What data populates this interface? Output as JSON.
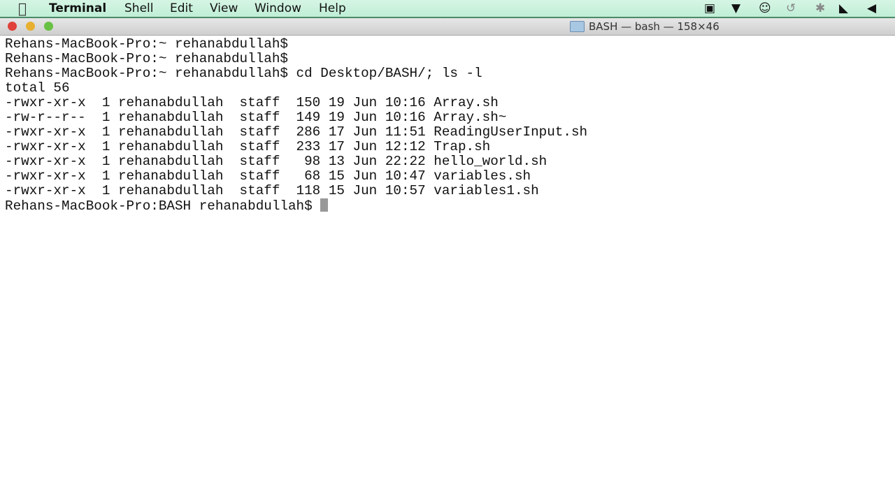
{
  "menubar": {
    "app": "Terminal",
    "items": [
      "Shell",
      "Edit",
      "View",
      "Window",
      "Help"
    ],
    "status_icons": [
      "screen-record-icon",
      "airplay-icon",
      "accessibility-icon",
      "time-machine-icon",
      "bluetooth-icon",
      "wifi-icon",
      "volume-icon"
    ]
  },
  "window": {
    "title": "BASH — bash — 158×46"
  },
  "terminal": {
    "lines": [
      "Rehans-MacBook-Pro:~ rehanabdullah$",
      "Rehans-MacBook-Pro:~ rehanabdullah$",
      "Rehans-MacBook-Pro:~ rehanabdullah$ cd Desktop/BASH/; ls -l",
      "total 56",
      "-rwxr-xr-x  1 rehanabdullah  staff  150 19 Jun 10:16 Array.sh",
      "-rw-r--r--  1 rehanabdullah  staff  149 19 Jun 10:16 Array.sh~",
      "-rwxr-xr-x  1 rehanabdullah  staff  286 17 Jun 11:51 ReadingUserInput.sh",
      "-rwxr-xr-x  1 rehanabdullah  staff  233 17 Jun 12:12 Trap.sh",
      "-rwxr-xr-x  1 rehanabdullah  staff   98 13 Jun 22:22 hello_world.sh",
      "-rwxr-xr-x  1 rehanabdullah  staff   68 15 Jun 10:47 variables.sh",
      "-rwxr-xr-x  1 rehanabdullah  staff  118 15 Jun 10:57 variables1.sh"
    ],
    "prompt": "Rehans-MacBook-Pro:BASH rehanabdullah$ "
  }
}
